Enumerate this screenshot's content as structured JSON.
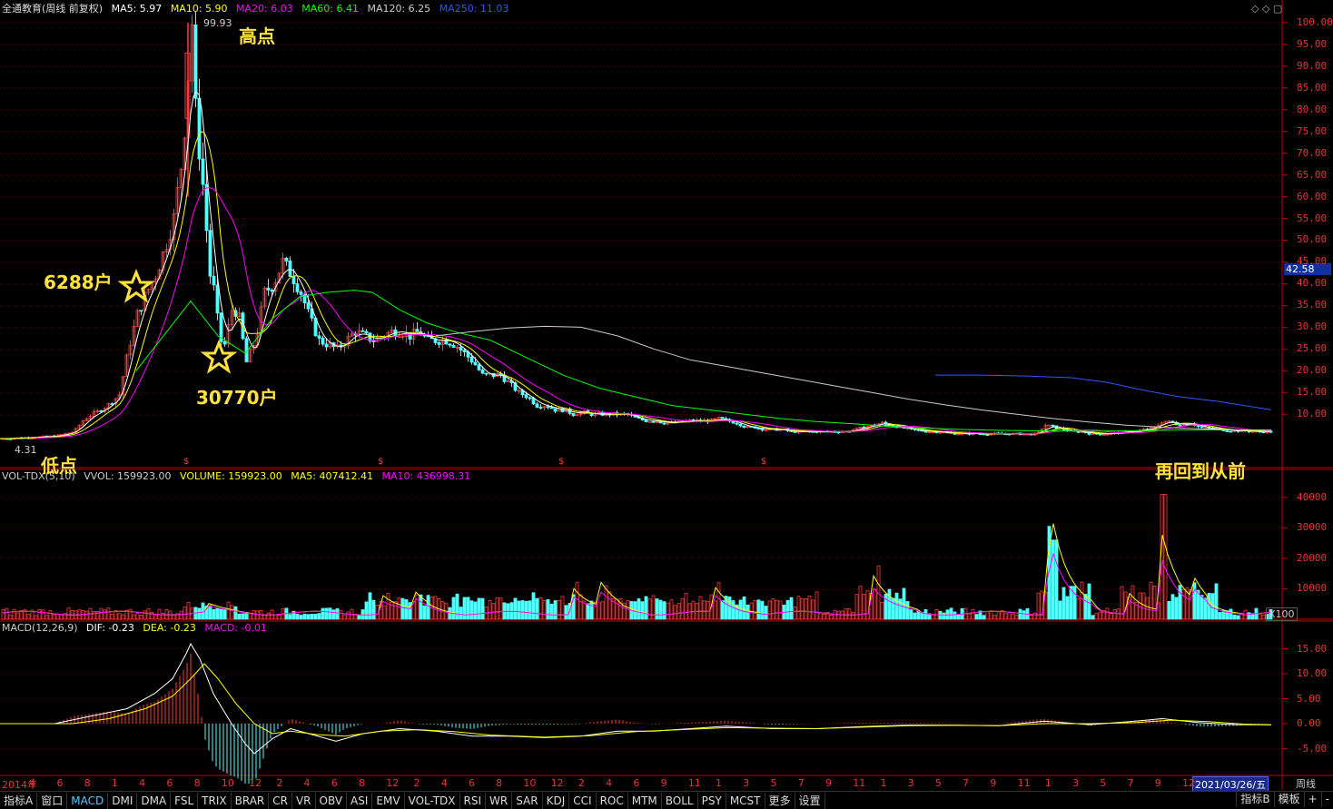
{
  "header": {
    "title": "全通教育(周线 前复权)",
    "ma": [
      {
        "label": "MA5: 5.97",
        "color": "#ffffff"
      },
      {
        "label": "MA10: 5.90",
        "color": "#ffff00"
      },
      {
        "label": "MA20: 6.03",
        "color": "#ff00ff"
      },
      {
        "label": "MA60: 6.41",
        "color": "#00ff00"
      },
      {
        "label": "MA120: 6.25",
        "color": "#cccccc"
      },
      {
        "label": "MA250: 11.03",
        "color": "#3355ff"
      }
    ]
  },
  "vol_header": {
    "title": "VOL-TDX(5,10)",
    "items": [
      {
        "label": "VVOL: 159923.00",
        "color": "#cccccc"
      },
      {
        "label": "VOLUME: 159923.00",
        "color": "#ffff00"
      },
      {
        "label": "MA5: 407412.41",
        "color": "#ffff00"
      },
      {
        "label": "MA10: 436998.31",
        "color": "#ff00ff"
      }
    ]
  },
  "macd_header": {
    "title": "MACD(12,26,9)",
    "items": [
      {
        "label": "DIF: -0.23",
        "color": "#ffffff"
      },
      {
        "label": "DEA: -0.23",
        "color": "#ffff00"
      },
      {
        "label": "MACD: -0.01",
        "color": "#ff00ff"
      }
    ]
  },
  "annotations": {
    "high": "高点",
    "low": "低点",
    "holders_a": "6288户",
    "holders_b": "30770户",
    "back": "再回到从前",
    "high_price": "99.93",
    "low_price": "4.31",
    "current_price": "42.58",
    "date_badge": "2021/03/26/五",
    "period_label": "周线",
    "vol_unit": "X100"
  },
  "tabs": [
    "指标A",
    "窗口",
    "MACD",
    "DMI",
    "DMA",
    "FSL",
    "TRIX",
    "BRAR",
    "CR",
    "VR",
    "OBV",
    "ASI",
    "EMV",
    "VOL-TDX",
    "RSI",
    "WR",
    "SAR",
    "KDJ",
    "CCI",
    "ROC",
    "MTM",
    "BOLL",
    "PSY",
    "MCST",
    "更多",
    "设置"
  ],
  "right_tabs": [
    "指标B",
    "模板",
    "+",
    "-"
  ],
  "chart_data": [
    {
      "type": "candlestick",
      "title": "全通教育(周线 前复权)",
      "ylim": [
        4,
        101
      ],
      "y_ticks": [
        10,
        15,
        20,
        25,
        30,
        35,
        40,
        45,
        50,
        55,
        60,
        65,
        70,
        75,
        80,
        85,
        90,
        95,
        100
      ],
      "x_tick_labels": [
        "2014年",
        "4",
        "6",
        "8",
        "1",
        "4",
        "6",
        "8",
        "10",
        "12",
        "2",
        "4",
        "6",
        "8",
        "12",
        "2",
        "4",
        "6",
        "8",
        "10",
        "12",
        "2",
        "4",
        "6",
        "9",
        "11",
        "1",
        "3",
        "5",
        "7",
        "9",
        "11",
        "1",
        "3",
        "5",
        "7",
        "9",
        "11",
        "1",
        "3",
        "5",
        "7",
        "9",
        "12"
      ],
      "close_path": [
        [
          0,
          4.4
        ],
        [
          25,
          4.6
        ],
        [
          45,
          4.8
        ],
        [
          60,
          5.0
        ],
        [
          70,
          5.5
        ],
        [
          80,
          6.0
        ],
        [
          90,
          8.5
        ],
        [
          100,
          10
        ],
        [
          110,
          11
        ],
        [
          120,
          12.5
        ],
        [
          130,
          14.5
        ],
        [
          140,
          25
        ],
        [
          150,
          33
        ],
        [
          160,
          38
        ],
        [
          170,
          42
        ],
        [
          180,
          48
        ],
        [
          190,
          55
        ],
        [
          200,
          70
        ],
        [
          205,
          85
        ],
        [
          210,
          99.93
        ],
        [
          215,
          75
        ],
        [
          220,
          68
        ],
        [
          225,
          55
        ],
        [
          230,
          42
        ],
        [
          235,
          38
        ],
        [
          240,
          28
        ],
        [
          245,
          25
        ],
        [
          250,
          30
        ],
        [
          255,
          35
        ],
        [
          262,
          32
        ],
        [
          270,
          22
        ],
        [
          280,
          27
        ],
        [
          290,
          38
        ],
        [
          300,
          40
        ],
        [
          310,
          45
        ],
        [
          320,
          42
        ],
        [
          330,
          38
        ],
        [
          340,
          32
        ],
        [
          350,
          27
        ],
        [
          360,
          26
        ],
        [
          370,
          25
        ],
        [
          380,
          27
        ],
        [
          390,
          29
        ],
        [
          400,
          28
        ],
        [
          410,
          27
        ],
        [
          420,
          28
        ],
        [
          430,
          29
        ],
        [
          440,
          29
        ],
        [
          450,
          28
        ],
        [
          460,
          29
        ],
        [
          470,
          27
        ],
        [
          480,
          27
        ],
        [
          490,
          27
        ],
        [
          500,
          26
        ],
        [
          510,
          24
        ],
        [
          520,
          22
        ],
        [
          530,
          19
        ],
        [
          540,
          19
        ],
        [
          550,
          19
        ],
        [
          560,
          17
        ],
        [
          570,
          15
        ],
        [
          580,
          14
        ],
        [
          590,
          12
        ],
        [
          600,
          12
        ],
        [
          610,
          11
        ],
        [
          620,
          11
        ],
        [
          630,
          10
        ],
        [
          640,
          10.5
        ],
        [
          650,
          10
        ],
        [
          660,
          10
        ],
        [
          670,
          10
        ],
        [
          680,
          10
        ],
        [
          690,
          10
        ],
        [
          700,
          9
        ],
        [
          710,
          8.5
        ],
        [
          720,
          8.5
        ],
        [
          730,
          8
        ],
        [
          740,
          8
        ],
        [
          750,
          8.5
        ],
        [
          760,
          8.5
        ],
        [
          770,
          8.5
        ],
        [
          780,
          8.5
        ],
        [
          790,
          9
        ],
        [
          800,
          8.5
        ],
        [
          810,
          8
        ],
        [
          820,
          7
        ],
        [
          830,
          7
        ],
        [
          840,
          6.5
        ],
        [
          850,
          6.5
        ],
        [
          860,
          6.5
        ],
        [
          870,
          6
        ],
        [
          880,
          6
        ],
        [
          890,
          6
        ],
        [
          900,
          6
        ],
        [
          910,
          6
        ],
        [
          920,
          6
        ],
        [
          930,
          6
        ],
        [
          940,
          6.5
        ],
        [
          950,
          7
        ],
        [
          960,
          7.5
        ],
        [
          970,
          8
        ],
        [
          980,
          7.5
        ],
        [
          990,
          7
        ],
        [
          1000,
          6.5
        ],
        [
          1010,
          6.3
        ],
        [
          1020,
          6
        ],
        [
          1030,
          6
        ],
        [
          1040,
          5.8
        ],
        [
          1050,
          5.6
        ],
        [
          1060,
          5.5
        ],
        [
          1070,
          5.6
        ],
        [
          1080,
          5.5
        ],
        [
          1090,
          5.5
        ],
        [
          1100,
          5.5
        ],
        [
          1110,
          5.5
        ],
        [
          1120,
          5.5
        ],
        [
          1130,
          5.4
        ],
        [
          1140,
          5.5
        ],
        [
          1150,
          7.5
        ],
        [
          1160,
          7
        ],
        [
          1170,
          6.5
        ],
        [
          1180,
          6
        ],
        [
          1190,
          6
        ],
        [
          1200,
          5.5
        ],
        [
          1210,
          5.5
        ],
        [
          1220,
          5.5
        ],
        [
          1230,
          5.8
        ],
        [
          1240,
          6
        ],
        [
          1250,
          6.2
        ],
        [
          1260,
          6.5
        ],
        [
          1270,
          7
        ],
        [
          1280,
          8.5
        ],
        [
          1290,
          8
        ],
        [
          1300,
          7.5
        ],
        [
          1310,
          8
        ],
        [
          1320,
          7
        ],
        [
          1330,
          6.8
        ],
        [
          1340,
          6.5
        ],
        [
          1350,
          6.3
        ],
        [
          1360,
          6.2
        ],
        [
          1370,
          6.2
        ],
        [
          1380,
          6
        ],
        [
          1390,
          6
        ],
        [
          1400,
          5.97
        ]
      ],
      "ma_lines": [
        {
          "name": "MA60",
          "color": "#00ff00",
          "points": [
            [
              150,
              20
            ],
            [
              180,
              28
            ],
            [
              210,
              36
            ],
            [
              240,
              28
            ],
            [
              270,
              24
            ],
            [
              300,
              32
            ],
            [
              330,
              37
            ],
            [
              360,
              38
            ],
            [
              390,
              38.5
            ],
            [
              410,
              38
            ],
            [
              440,
              34
            ],
            [
              470,
              31
            ],
            [
              500,
              29
            ],
            [
              540,
              27
            ],
            [
              580,
              23
            ],
            [
              620,
              19
            ],
            [
              660,
              16
            ],
            [
              700,
              14
            ],
            [
              740,
              12
            ],
            [
              780,
              11
            ],
            [
              820,
              10
            ],
            [
              860,
              9
            ],
            [
              900,
              8.3
            ],
            [
              940,
              7.8
            ],
            [
              980,
              7.2
            ],
            [
              1020,
              6.8
            ],
            [
              1060,
              6.5
            ],
            [
              1100,
              6.3
            ],
            [
              1150,
              6.2
            ],
            [
              1200,
              6.1
            ],
            [
              1250,
              6.2
            ],
            [
              1300,
              6.4
            ],
            [
              1350,
              6.4
            ],
            [
              1400,
              6.41
            ]
          ]
        },
        {
          "name": "MA120",
          "color": "#cccccc",
          "points": [
            [
              480,
              28
            ],
            [
              520,
              29
            ],
            [
              560,
              29.8
            ],
            [
              600,
              30.2
            ],
            [
              640,
              30
            ],
            [
              680,
              28
            ],
            [
              720,
              25
            ],
            [
              760,
              22.5
            ],
            [
              800,
              21
            ],
            [
              840,
              19.5
            ],
            [
              880,
              18
            ],
            [
              920,
              16.5
            ],
            [
              960,
              15
            ],
            [
              1000,
              13.5
            ],
            [
              1040,
              12.2
            ],
            [
              1080,
              11
            ],
            [
              1120,
              10
            ],
            [
              1160,
              9
            ],
            [
              1200,
              8.2
            ],
            [
              1240,
              7.5
            ],
            [
              1280,
              7
            ],
            [
              1320,
              6.7
            ],
            [
              1360,
              6.4
            ],
            [
              1400,
              6.25
            ]
          ]
        },
        {
          "name": "MA250",
          "color": "#3355ff",
          "points": [
            [
              1030,
              19
            ],
            [
              1080,
              19
            ],
            [
              1130,
              18.8
            ],
            [
              1180,
              18.4
            ],
            [
              1220,
              17.3
            ],
            [
              1260,
              15.5
            ],
            [
              1300,
              14
            ],
            [
              1340,
              13
            ],
            [
              1370,
              12
            ],
            [
              1400,
              11.03
            ]
          ]
        }
      ]
    },
    {
      "type": "bar",
      "title": "VOL-TDX(5,10)",
      "ylim": [
        0,
        45000
      ],
      "y_ticks": [
        10000,
        20000,
        30000,
        40000
      ],
      "unit": "X100",
      "spikes": [
        [
          230,
          4500
        ],
        [
          425,
          8500
        ],
        [
          460,
          8000
        ],
        [
          635,
          12000
        ],
        [
          665,
          11000
        ],
        [
          790,
          12000
        ],
        [
          965,
          17500
        ],
        [
          1155,
          30500
        ],
        [
          1160,
          26000
        ],
        [
          1280,
          41000
        ],
        [
          1245,
          11000
        ],
        [
          1315,
          12000
        ]
      ]
    },
    {
      "type": "line",
      "title": "MACD(12,26,9)",
      "ylim": [
        -10,
        18
      ],
      "y_ticks": [
        -5,
        0,
        5,
        10,
        15
      ],
      "dif": [
        [
          0,
          0
        ],
        [
          60,
          0
        ],
        [
          100,
          1.5
        ],
        [
          140,
          3
        ],
        [
          170,
          6
        ],
        [
          190,
          9
        ],
        [
          205,
          14
        ],
        [
          210,
          16
        ],
        [
          220,
          13
        ],
        [
          235,
          6
        ],
        [
          255,
          0
        ],
        [
          270,
          -4
        ],
        [
          280,
          -6
        ],
        [
          300,
          -3
        ],
        [
          320,
          -1
        ],
        [
          340,
          -2
        ],
        [
          370,
          -3.5
        ],
        [
          400,
          -2
        ],
        [
          440,
          -1
        ],
        [
          480,
          -1.5
        ],
        [
          520,
          -2.5
        ],
        [
          560,
          -2.5
        ],
        [
          600,
          -2.8
        ],
        [
          640,
          -2.5
        ],
        [
          680,
          -1.5
        ],
        [
          720,
          -1.5
        ],
        [
          760,
          -1
        ],
        [
          800,
          -0.5
        ],
        [
          850,
          -1
        ],
        [
          900,
          -1
        ],
        [
          950,
          -0.6
        ],
        [
          1000,
          -0.3
        ],
        [
          1050,
          -0.3
        ],
        [
          1100,
          -0.4
        ],
        [
          1150,
          0.5
        ],
        [
          1200,
          -0.2
        ],
        [
          1250,
          0.5
        ],
        [
          1280,
          1
        ],
        [
          1320,
          0.2
        ],
        [
          1360,
          -0.2
        ],
        [
          1400,
          -0.23
        ]
      ],
      "dea": [
        [
          0,
          0
        ],
        [
          80,
          0
        ],
        [
          120,
          1
        ],
        [
          160,
          3
        ],
        [
          190,
          5.5
        ],
        [
          210,
          9
        ],
        [
          225,
          12
        ],
        [
          240,
          9
        ],
        [
          260,
          4
        ],
        [
          280,
          0
        ],
        [
          300,
          -2
        ],
        [
          320,
          -1.5
        ],
        [
          350,
          -2.2
        ],
        [
          380,
          -2.5
        ],
        [
          420,
          -1.5
        ],
        [
          460,
          -1.2
        ],
        [
          500,
          -1.6
        ],
        [
          540,
          -2.3
        ],
        [
          600,
          -2.7
        ],
        [
          650,
          -2.4
        ],
        [
          700,
          -1.6
        ],
        [
          750,
          -1.2
        ],
        [
          800,
          -0.8
        ],
        [
          850,
          -0.9
        ],
        [
          900,
          -1
        ],
        [
          950,
          -0.7
        ],
        [
          1000,
          -0.4
        ],
        [
          1050,
          -0.35
        ],
        [
          1100,
          -0.4
        ],
        [
          1150,
          0
        ],
        [
          1200,
          0
        ],
        [
          1250,
          0.2
        ],
        [
          1290,
          0.7
        ],
        [
          1330,
          0.4
        ],
        [
          1370,
          -0.1
        ],
        [
          1400,
          -0.23
        ]
      ]
    }
  ]
}
